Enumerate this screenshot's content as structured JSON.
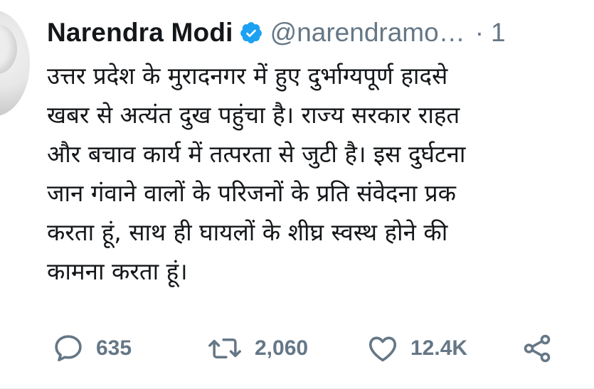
{
  "tweet": {
    "author_name": "Narendra Modi",
    "handle": "@narendramo…",
    "separator": "·",
    "time": "1",
    "verified_icon": "verified-badge-icon",
    "text_lines": [
      "उत्तर प्रदेश के मुरादनगर में हुए दुर्भाग्यपूर्ण हादसे",
      "खबर से अत्यंत दुख पहुंचा है। राज्य सरकार राहत",
      "और बचाव कार्य में तत्परता से जुटी है। इस दुर्घटना",
      "जान गंवाने वालों के परिजनों के प्रति संवेदना प्रक",
      "करता हूं, साथ ही घायलों के शीघ्र स्वस्थ होने की",
      "कामना करता हूं।"
    ]
  },
  "actions": {
    "reply": {
      "icon": "reply-icon",
      "count": "635"
    },
    "retweet": {
      "icon": "retweet-icon",
      "count": "2,060"
    },
    "like": {
      "icon": "like-heart-icon",
      "count": "12.4K"
    },
    "share": {
      "icon": "share-icon"
    }
  },
  "colors": {
    "text": "#14171a",
    "secondary": "#657786",
    "verified": "#1da1f2"
  }
}
